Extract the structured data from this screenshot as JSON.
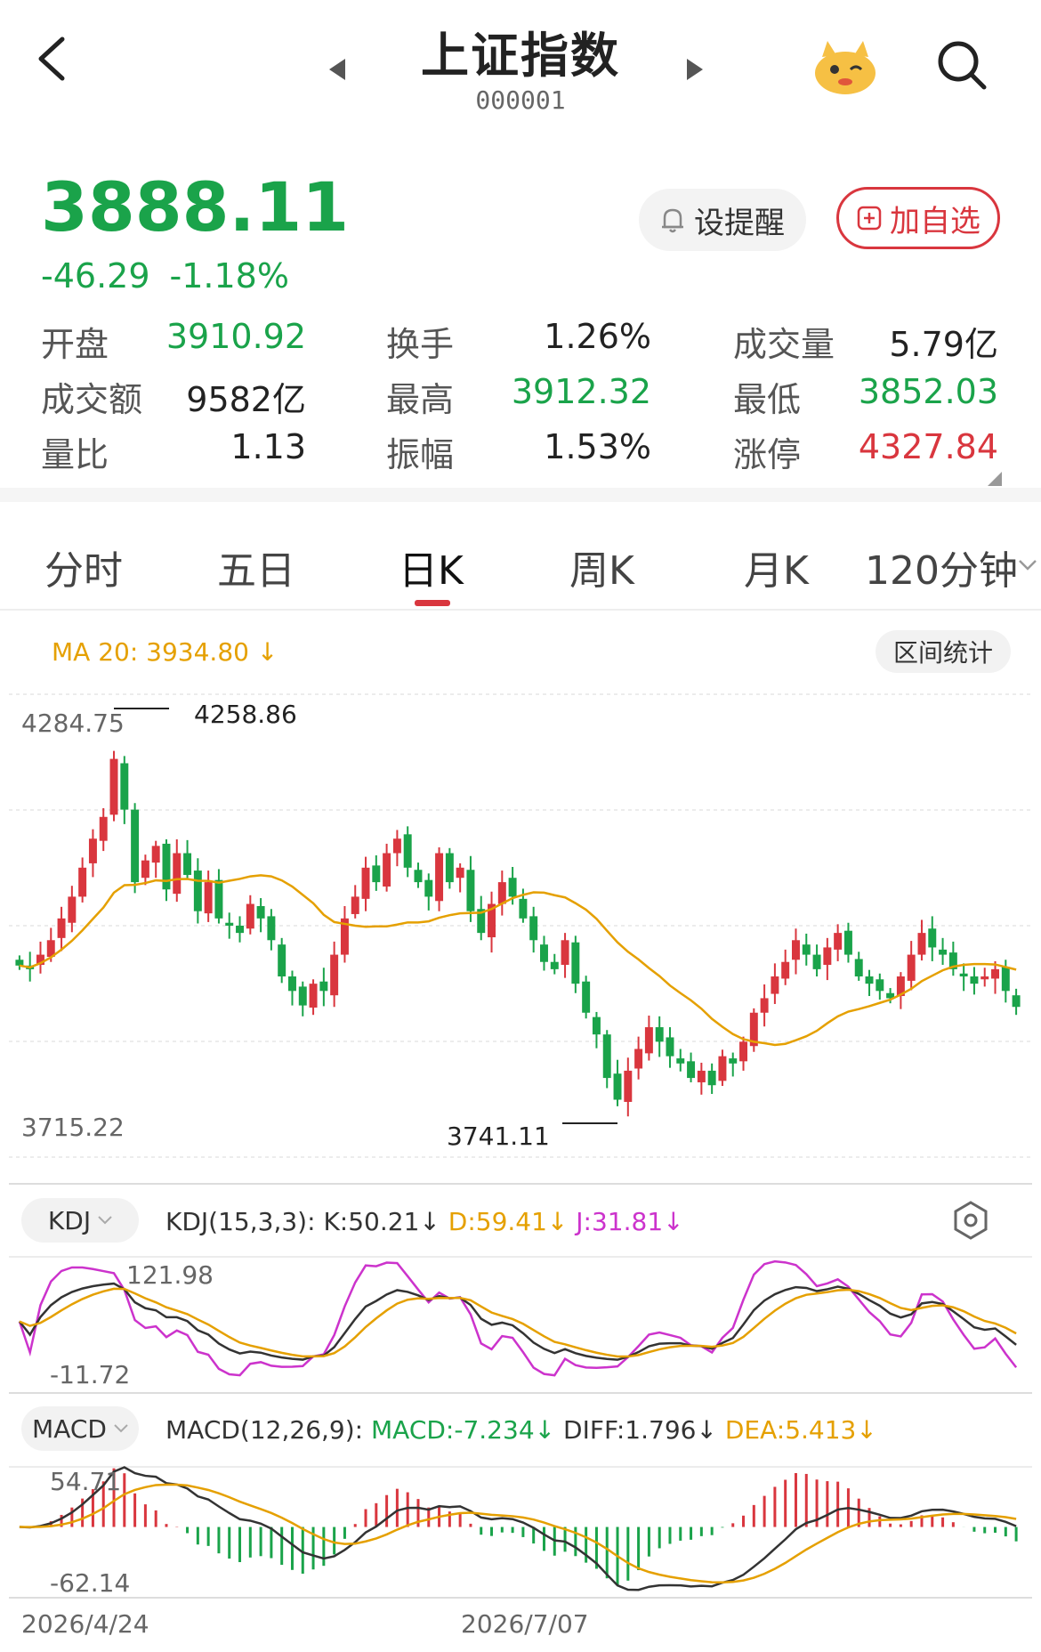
{
  "header": {
    "title": "上证指数",
    "code": "000001"
  },
  "quote": {
    "price": "3888.11",
    "change": "-46.29",
    "change_pct": "-1.18%",
    "remind_label": "设提醒",
    "fav_label": "加自选"
  },
  "stats": [
    {
      "label": "开盘",
      "value": "3910.92",
      "color": "#1aa34a"
    },
    {
      "label": "换手",
      "value": "1.26%",
      "color": "#222222"
    },
    {
      "label": "成交量",
      "value": "5.79亿",
      "color": "#222222"
    },
    {
      "label": "成交额",
      "value": "9582亿",
      "color": "#222222"
    },
    {
      "label": "最高",
      "value": "3912.32",
      "color": "#1aa34a"
    },
    {
      "label": "最低",
      "value": "3852.03",
      "color": "#1aa34a"
    },
    {
      "label": "量比",
      "value": "1.13",
      "color": "#222222"
    },
    {
      "label": "振幅",
      "value": "1.53%",
      "color": "#222222"
    },
    {
      "label": "涨停",
      "value": "4327.84",
      "color": "#d9363e"
    }
  ],
  "tabs": [
    {
      "label": "分时"
    },
    {
      "label": "五日"
    },
    {
      "label": "日K"
    },
    {
      "label": "周K"
    },
    {
      "label": "月K"
    },
    {
      "label": "120分钟"
    }
  ],
  "active_tab": "日K",
  "chart": {
    "ma_label": "MA 20: 3934.80",
    "range_button": "区间统计",
    "y_top": "4284.75",
    "y_bottom": "3715.22",
    "high_label": "4258.86",
    "low_label": "3741.11",
    "kdj_button": "KDJ",
    "kdj_params": "KDJ(15,3,3):",
    "kdj_k": "K:50.21",
    "kdj_d": "D:59.41",
    "kdj_j": "J:31.81",
    "kdj_top": "121.98",
    "kdj_bottom": "-11.72",
    "macd_button": "MACD",
    "macd_params": "MACD(12,26,9):",
    "macd_val": "MACD:-7.234",
    "macd_diff": "DIFF:1.796",
    "macd_dea": "DEA:5.413",
    "macd_top": "54.71",
    "macd_bottom": "-62.14",
    "date_start": "2026/4/24",
    "date_mid": "2026/7/07"
  },
  "colors": {
    "up": "#d9363e",
    "down": "#1aa34a",
    "ma": "#e5a000",
    "kdj_k": "#333333",
    "kdj_d": "#e5a000",
    "kdj_j": "#cc33cc"
  },
  "chart_data": {
    "type": "candlestick",
    "series": [
      {
        "name": "K",
        "values": []
      }
    ],
    "close": [
      3945,
      3940,
      3960,
      3980,
      4010,
      4040,
      4080,
      4120,
      4150,
      4230,
      4160,
      4060,
      4090,
      4110,
      4050,
      4100,
      4070,
      4020,
      4060,
      4010,
      4000,
      3990,
      4030,
      4010,
      3980,
      3930,
      3910,
      3890,
      3920,
      3910,
      3960,
      4010,
      4040,
      4080,
      4060,
      4100,
      4120,
      4080,
      4060,
      4040,
      4100,
      4060,
      4080,
      4020,
      3990,
      4030,
      4060,
      4040,
      4010,
      3980,
      3950,
      3940,
      3980,
      3920,
      3880,
      3850,
      3790,
      3760,
      3800,
      3830,
      3860,
      3840,
      3820,
      3810,
      3790,
      3800,
      3780,
      3820,
      3810,
      3840,
      3880,
      3900,
      3930,
      3950,
      3980,
      3960,
      3940,
      3970,
      3990,
      3960,
      3930,
      3920,
      3910,
      3900,
      3930,
      3960,
      3990,
      3970,
      3960,
      3940,
      3930,
      3920,
      3930,
      3940,
      3910,
      3888
    ],
    "ma20_label": "MA 20",
    "ylim": [
      3715.22,
      4284.75
    ]
  }
}
